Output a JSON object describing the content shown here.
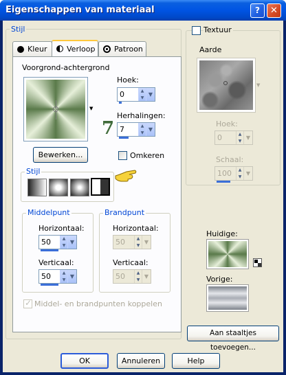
{
  "window": {
    "title": "Eigenschappen van materiaal",
    "help_btn": "?",
    "close_btn": "✕"
  },
  "stijl_group": {
    "label": "Stijl"
  },
  "tabs": [
    {
      "label": "Kleur",
      "icon": "circle-icon"
    },
    {
      "label": "Verloop",
      "icon": "half-circle-icon"
    },
    {
      "label": "Patroon",
      "icon": "pattern-icon"
    }
  ],
  "gradient": {
    "preset_label": "Voorgrond-achtergrond",
    "hoek_label": "Hoek:",
    "hoek_value": "0",
    "herhalingen_label": "Herhalingen:",
    "herhalingen_value": "7",
    "annotation": "7",
    "edit_button": "Bewerken...",
    "omkeren_label": "Omkeren",
    "stijl_label": "Stijl"
  },
  "middelpunt": {
    "label": "Middelpunt",
    "horizontaal_label": "Horizontaal:",
    "horizontaal_value": "50",
    "verticaal_label": "Verticaal:",
    "verticaal_value": "50"
  },
  "brandpunt": {
    "label": "Brandpunt",
    "horizontaal_label": "Horizontaal:",
    "horizontaal_value": "50",
    "verticaal_label": "Verticaal:",
    "verticaal_value": "50"
  },
  "link_label": "Middel- en brandpunten koppelen",
  "textuur": {
    "label": "Textuur",
    "texture_name": "Aarde",
    "hoek_label": "Hoek:",
    "hoek_value": "0",
    "schaal_label": "Schaal:",
    "schaal_value": "100"
  },
  "huidige_label": "Huidige:",
  "vorige_label": "Vorige:",
  "swatch_button": "Aan staaltjes toevoegen...",
  "footer": {
    "ok": "OK",
    "cancel": "Annuleren",
    "help": "Help"
  },
  "colors": {
    "title_blue": "#0054e3",
    "accent_blue": "#0046d5",
    "gradient_dark": "#5a7a4a",
    "gradient_light": "#e6efd9",
    "annotation_green": "#3f6b3a"
  }
}
